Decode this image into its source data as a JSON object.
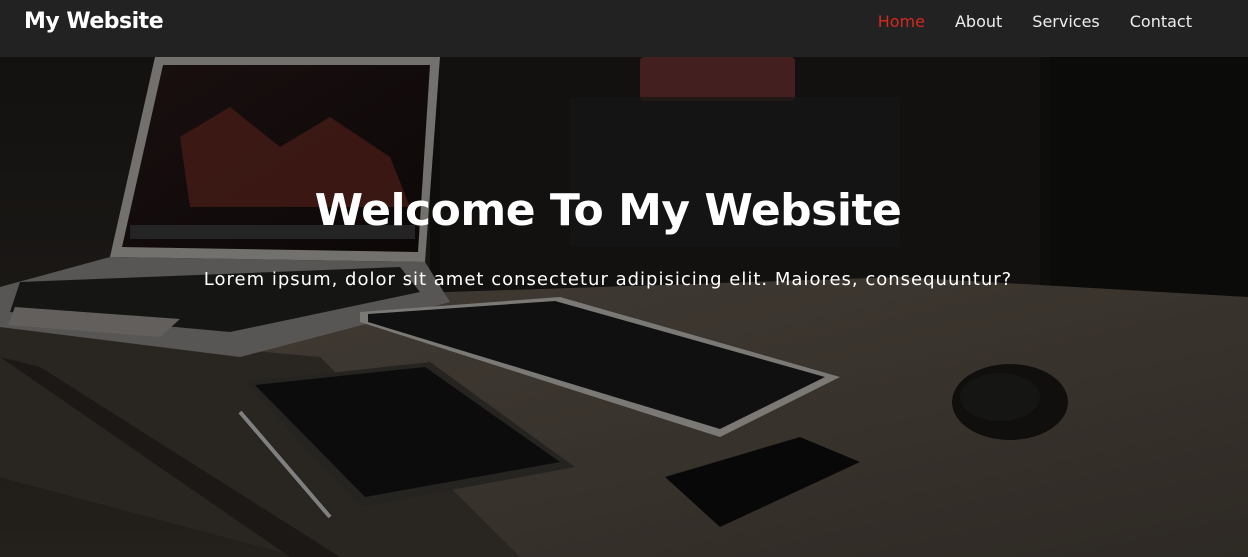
{
  "navbar": {
    "brand": "My Website",
    "links": [
      {
        "label": "Home",
        "active": true
      },
      {
        "label": "About",
        "active": false
      },
      {
        "label": "Services",
        "active": false
      },
      {
        "label": "Contact",
        "active": false
      }
    ],
    "active_color": "#d22a1e"
  },
  "hero": {
    "title": "Welcome To My Website",
    "subtitle": "Lorem ipsum, dolor sit amet consectetur adipisicing elit. Maiores, consequuntur?",
    "background_image": "dark desk with laptop, keyboard, tablet, phone and mouse"
  }
}
